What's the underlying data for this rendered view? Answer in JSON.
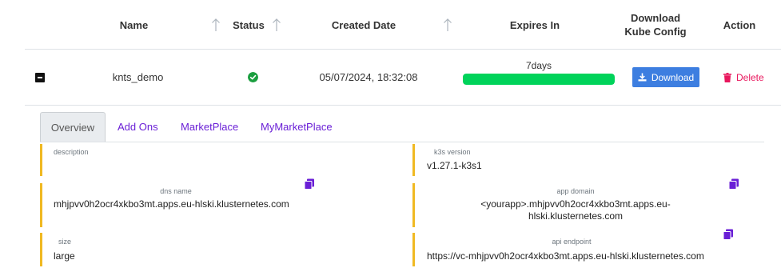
{
  "table": {
    "headers": {
      "name": "Name",
      "status": "Status",
      "created": "Created Date",
      "expires": "Expires In",
      "download_line1": "Download",
      "download_line2": "Kube Config",
      "action": "Action"
    },
    "row": {
      "name": "knts_demo",
      "status": "ready",
      "created": "05/07/2024, 18:32:08",
      "expires_label": "7days",
      "expires_progress": 1.0,
      "download_label": "Download",
      "delete_label": "Delete"
    }
  },
  "tabs": [
    {
      "label": "Overview",
      "active": true
    },
    {
      "label": "Add Ons",
      "active": false
    },
    {
      "label": "MarketPlace",
      "active": false
    },
    {
      "label": "MyMarketPlace",
      "active": false
    }
  ],
  "details": {
    "description": {
      "label": "description",
      "value": ""
    },
    "k3s_version": {
      "label": "k3s version",
      "value": "v1.27.1-k3s1"
    },
    "dns_name": {
      "label": "dns name",
      "value": "mhjpvv0h2ocr4xkbo3mt.apps.eu-hlski.klusternetes.com"
    },
    "app_domain": {
      "label": "app domain",
      "value_line1": "<yourapp>.mhjpvv0h2ocr4xkbo3mt.apps.eu-",
      "value_line2": "hlski.klusternetes.com"
    },
    "size": {
      "label": "size",
      "value": "large"
    },
    "api_endpoint": {
      "label": "api endpoint",
      "value": "https://vc-mhjpvv0h2ocr4xkbo3mt.apps.eu-hlski.klusternetes.com"
    }
  },
  "colors": {
    "accent_purple": "#6a1fd6",
    "progress_green": "#00d35a",
    "status_green": "#1a9e3f",
    "download_blue": "#3d7ee0",
    "delete_pink": "#e8175d",
    "card_border": "#f0b922"
  },
  "icons": {
    "sort": "arrow-up-icon",
    "status": "check-circle-icon",
    "expand": "minus-square-icon",
    "download": "download-icon",
    "delete": "trash-icon",
    "copy": "copy-icon"
  }
}
